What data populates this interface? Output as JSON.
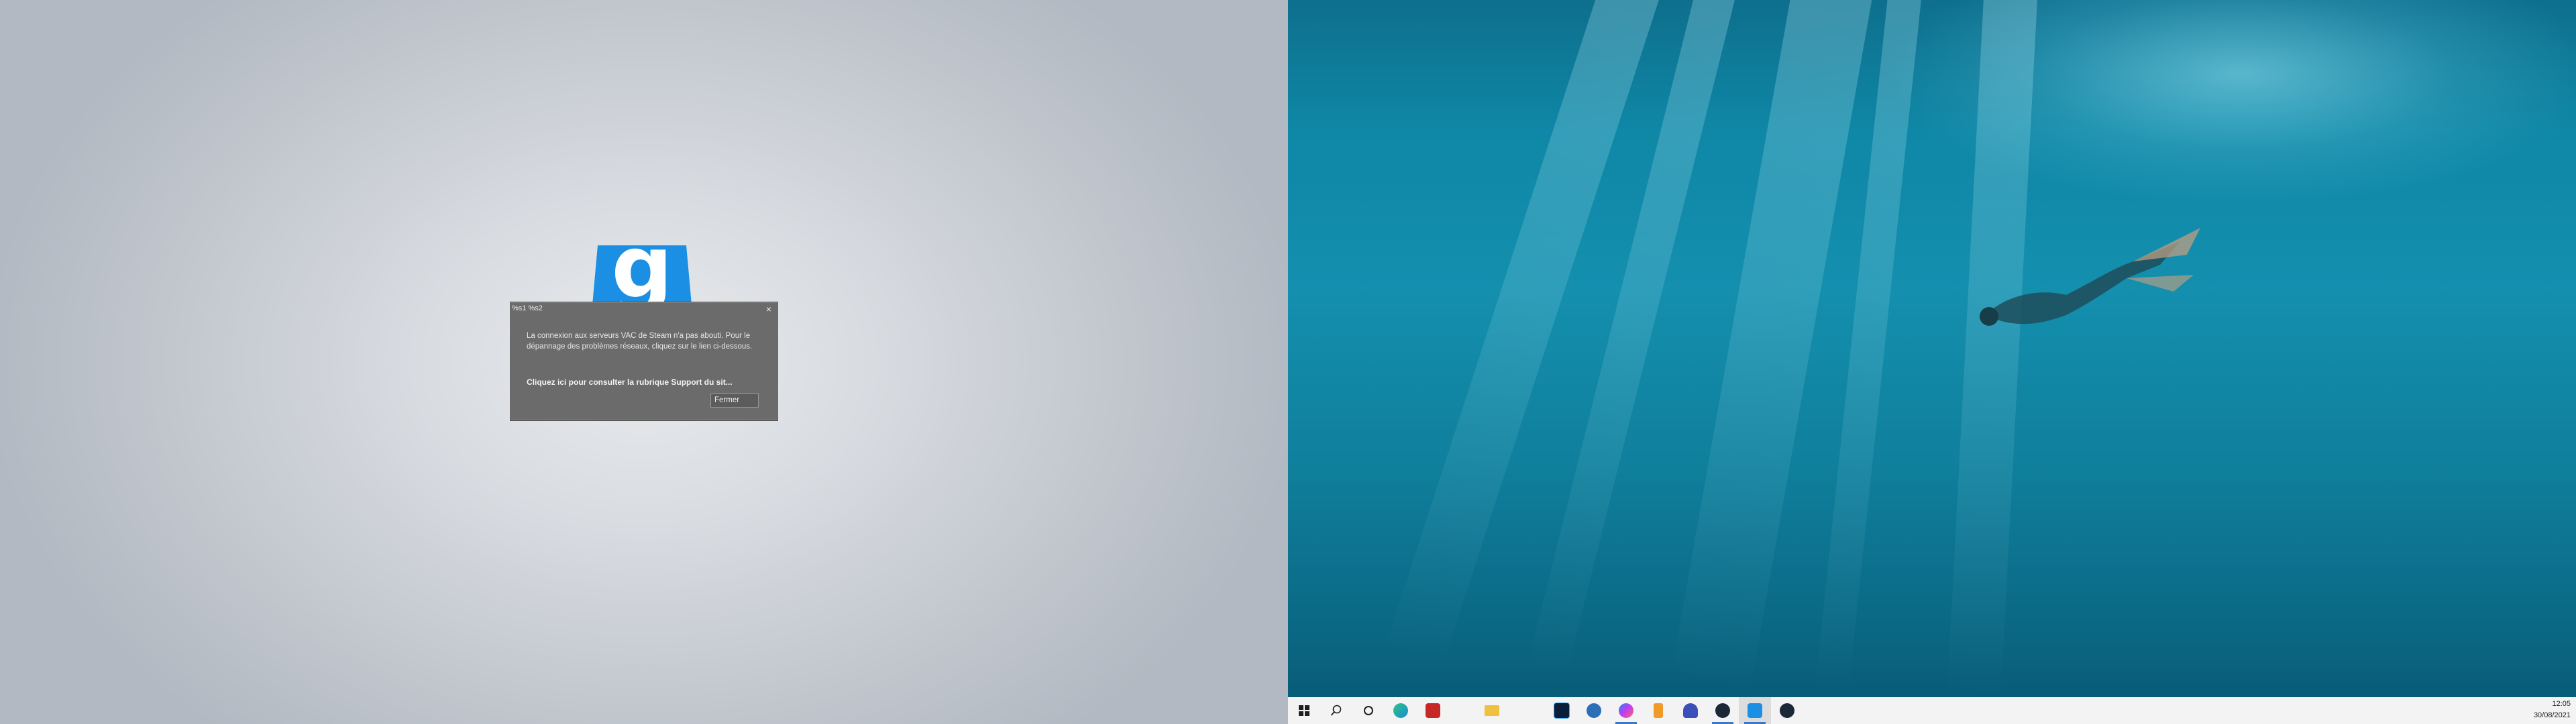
{
  "left_screen": {
    "logo_letter": "g",
    "dialog": {
      "title": "%s1 %s2",
      "close_glyph": "×",
      "message": "La connexion aux serveurs VAC de Steam n'a pas abouti. Pour le dépannage des problèmes réseaux, cliquez sur le lien ci-dessous.",
      "support_link": "Cliquez ici pour consulter la rubrique Support du sit...",
      "close_button": "Fermer"
    }
  },
  "taskbar": {
    "items": [
      {
        "name": "start-button",
        "icon": "windows-icon"
      },
      {
        "name": "search-button",
        "icon": "search-icon"
      },
      {
        "name": "task-view-button",
        "icon": "cortana-icon"
      },
      {
        "name": "edge-button",
        "icon": "edge-icon"
      },
      {
        "name": "app-red-button",
        "icon": "red-app-icon"
      },
      {
        "name": "file-explorer-button",
        "icon": "folder-icon"
      },
      {
        "name": "photoshop-button",
        "icon": "photoshop-icon"
      },
      {
        "name": "app-blue-button",
        "icon": "blue-app-icon"
      },
      {
        "name": "messenger-button",
        "icon": "messenger-icon"
      },
      {
        "name": "app-orange-button",
        "icon": "orange-app-icon"
      },
      {
        "name": "headset-button",
        "icon": "headset-icon"
      },
      {
        "name": "steam-button",
        "icon": "steam-icon"
      },
      {
        "name": "gmod-button",
        "icon": "gmod-icon"
      },
      {
        "name": "steam2-button",
        "icon": "steam-icon"
      }
    ],
    "clock": {
      "time": "12:05",
      "date": "30/08/2021"
    }
  },
  "colors": {
    "gmod_blue": "#1a8fe3",
    "dialog_bg": "#6b6b6b",
    "taskbar_bg": "#f3f3f3",
    "taskbar_active": "#3a78c9"
  }
}
